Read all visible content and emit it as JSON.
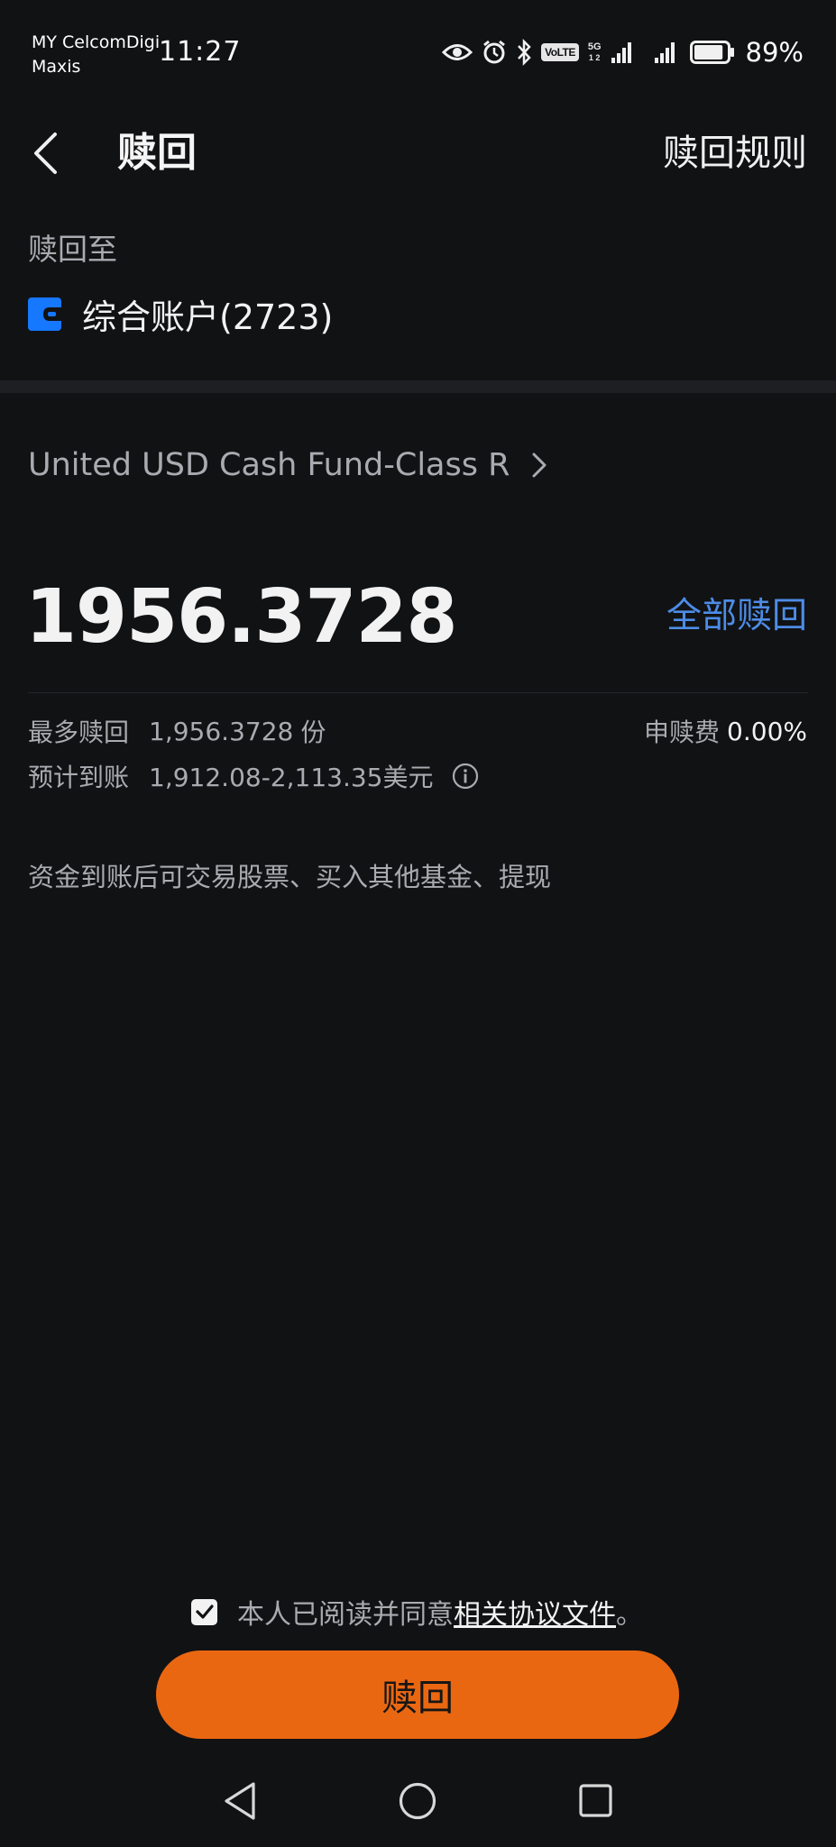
{
  "status_bar": {
    "carrier_line1": "MY CelcomDigi",
    "carrier_line2": "Maxis",
    "time": "11:27",
    "volte": "VoLTE",
    "sim_slots": "1 2",
    "network": "5G",
    "battery_percent": "89%",
    "battery_level": 0.89,
    "icons": [
      "eye-icon",
      "alarm-icon",
      "bluetooth-icon",
      "volte-icon",
      "signal-icon",
      "signal-icon",
      "battery-icon"
    ]
  },
  "header": {
    "title": "赎回",
    "rules_link": "赎回规则",
    "back_icon": "chevron-left-icon"
  },
  "redeem_to": {
    "label": "赎回至",
    "account": "综合账户(2723)",
    "account_icon": "wallet-icon",
    "account_icon_color": "#1677ff"
  },
  "fund": {
    "name": "United USD Cash Fund-Class R",
    "chevron_icon": "chevron-right-icon"
  },
  "amount": {
    "value": "1956.3728",
    "redeem_all_label": "全部赎回",
    "redeem_all_color": "#4d8ce6"
  },
  "details": {
    "max_label": "最多赎回",
    "max_value": "1,956.3728",
    "max_unit": "份",
    "fee_label": "申赎费",
    "fee_value": "0.00%",
    "expected_label": "预计到账",
    "expected_value": "1,912.08-2,113.35美元",
    "info_icon": "info-icon"
  },
  "note": "资金到账后可交易股票、买入其他基金、提现",
  "agreement": {
    "checked": true,
    "text": "本人已阅读并同意",
    "link": "相关协议文件",
    "suffix": "。"
  },
  "submit": {
    "label": "赎回",
    "color": "#ea6711"
  },
  "nav": {
    "back_icon": "nav-back-icon",
    "home_icon": "nav-home-icon",
    "recents_icon": "nav-recents-icon"
  }
}
